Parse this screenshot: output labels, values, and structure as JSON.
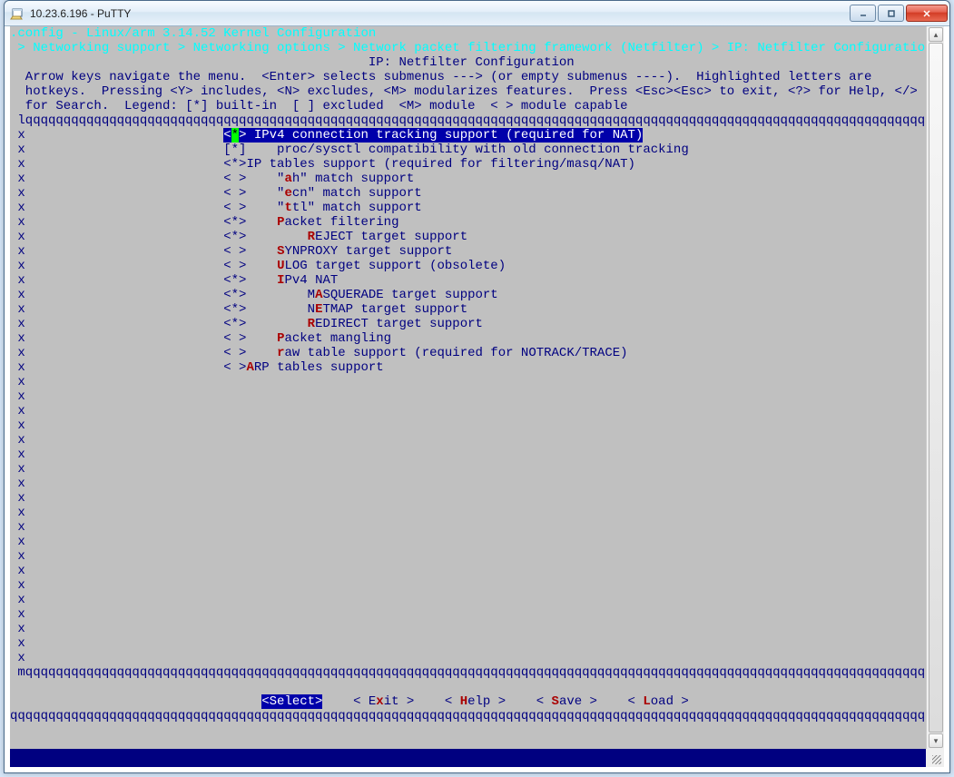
{
  "window": {
    "title": "10.23.6.196 - PuTTY"
  },
  "header": {
    "config_line": ".config - Linux/arm 3.14.52 Kernel Configuration",
    "breadcrumb": " > Networking support > Networking options > Network packet filtering framework (Netfilter) > IP: Netfilter Configuration qqqq",
    "page_title": "IP: Netfilter Configuration"
  },
  "help": {
    "line1": "  Arrow keys navigate the menu.  <Enter> selects submenus ---> (or empty submenus ----).  Highlighted letters are",
    "line2": "  hotkeys.  Pressing <Y> includes, <N> excludes, <M> modularizes features.  Press <Esc><Esc> to exit, <?> for Help, </>",
    "line3": "  for Search.  Legend: [*] built-in  [ ] excluded  <M> module  < > module capable"
  },
  "items": [
    {
      "state": "<*>",
      "indent": 0,
      "label": "IPv4 connection tracking support (required for NAT)",
      "hot": "",
      "selected": true
    },
    {
      "state": "[*]",
      "indent": 1,
      "pre": "p",
      "label": "roc/sysctl compatibility with old connection tracking",
      "hot": ""
    },
    {
      "state": "<*>",
      "indent": 0,
      "pre": "I",
      "label": "P tables support (required for filtering/masq/NAT)",
      "hot": ""
    },
    {
      "state": "< >",
      "indent": 1,
      "pre": "\"",
      "hot": "a",
      "label": "h\" match support"
    },
    {
      "state": "< >",
      "indent": 1,
      "pre": "\"",
      "hot": "e",
      "label": "cn\" match support"
    },
    {
      "state": "< >",
      "indent": 1,
      "pre": "\"",
      "hot": "t",
      "label": "tl\" match support"
    },
    {
      "state": "<*>",
      "indent": 1,
      "pre": "",
      "hot": "P",
      "label": "acket filtering"
    },
    {
      "state": "<*>",
      "indent": 2,
      "pre": "",
      "hot": "R",
      "label": "EJECT target support"
    },
    {
      "state": "< >",
      "indent": 1,
      "pre": "",
      "hot": "S",
      "label": "YNPROXY target support"
    },
    {
      "state": "< >",
      "indent": 1,
      "pre": "",
      "hot": "U",
      "label": "LOG target support (obsolete)"
    },
    {
      "state": "<*>",
      "indent": 1,
      "pre": "",
      "hot": "I",
      "label": "Pv4 NAT"
    },
    {
      "state": "<*>",
      "indent": 2,
      "pre": "M",
      "hot": "A",
      "label": "SQUERADE target support"
    },
    {
      "state": "<*>",
      "indent": 2,
      "pre": "N",
      "hot": "E",
      "label": "TMAP target support"
    },
    {
      "state": "<*>",
      "indent": 2,
      "pre": "",
      "hot": "R",
      "label": "EDIRECT target support"
    },
    {
      "state": "< >",
      "indent": 1,
      "pre": "",
      "hot": "P",
      "label": "acket mangling"
    },
    {
      "state": "< >",
      "indent": 1,
      "pre": "",
      "hot": "r",
      "label": "aw table support (required for NOTRACK/TRACE)"
    },
    {
      "state": "< >",
      "indent": 0,
      "pre": "",
      "hot": "A",
      "label": "RP tables support"
    }
  ],
  "buttons": {
    "select": "<Select>",
    "exit": {
      "pre": "< E",
      "hot": "x",
      "post": "it >"
    },
    "help": {
      "pre": "< ",
      "hot": "H",
      "post": "elp >"
    },
    "save": {
      "pre": "< ",
      "hot": "S",
      "post": "ave >"
    },
    "load": {
      "pre": "< ",
      "hot": "L",
      "post": "oad >"
    }
  },
  "chars": {
    "top_border": " lqqqqqqqqqqqqqqqqqqqqqqqqqqqqqqqqqqqqqqqqqqqqqqqqqqqqqqqqqqqqqqqqqqqqqqqqqqqqqqqqqqqqqqqqqqqqqqqqqqqqqqqqqqqqqqqqqqqqqqqk",
    "bot_border": " mqqqqqqqqqqqqqqqqqqqqqqqqqqqqqqqqqqqqqqqqqqqqqqqqqqqqqqqqqqqqqqqqqqqqqqqqqqqqqqqqqqqqqqqqqqqqqqqqqqqqqqqqqqqqqqqqqqqqqqqq",
    "final_q": "qqqqqqqqqqqqqqqqqqqqqqqqqqqqqqqqqqqqqqqqqqqqqqqqqqqqqqqqqqqqqqqqqqqqqqqqqqqqqqqqqqqqqqqqqqqqqqqqqqqqqqqqqqqqqqqqqqqqqqqqqq"
  }
}
